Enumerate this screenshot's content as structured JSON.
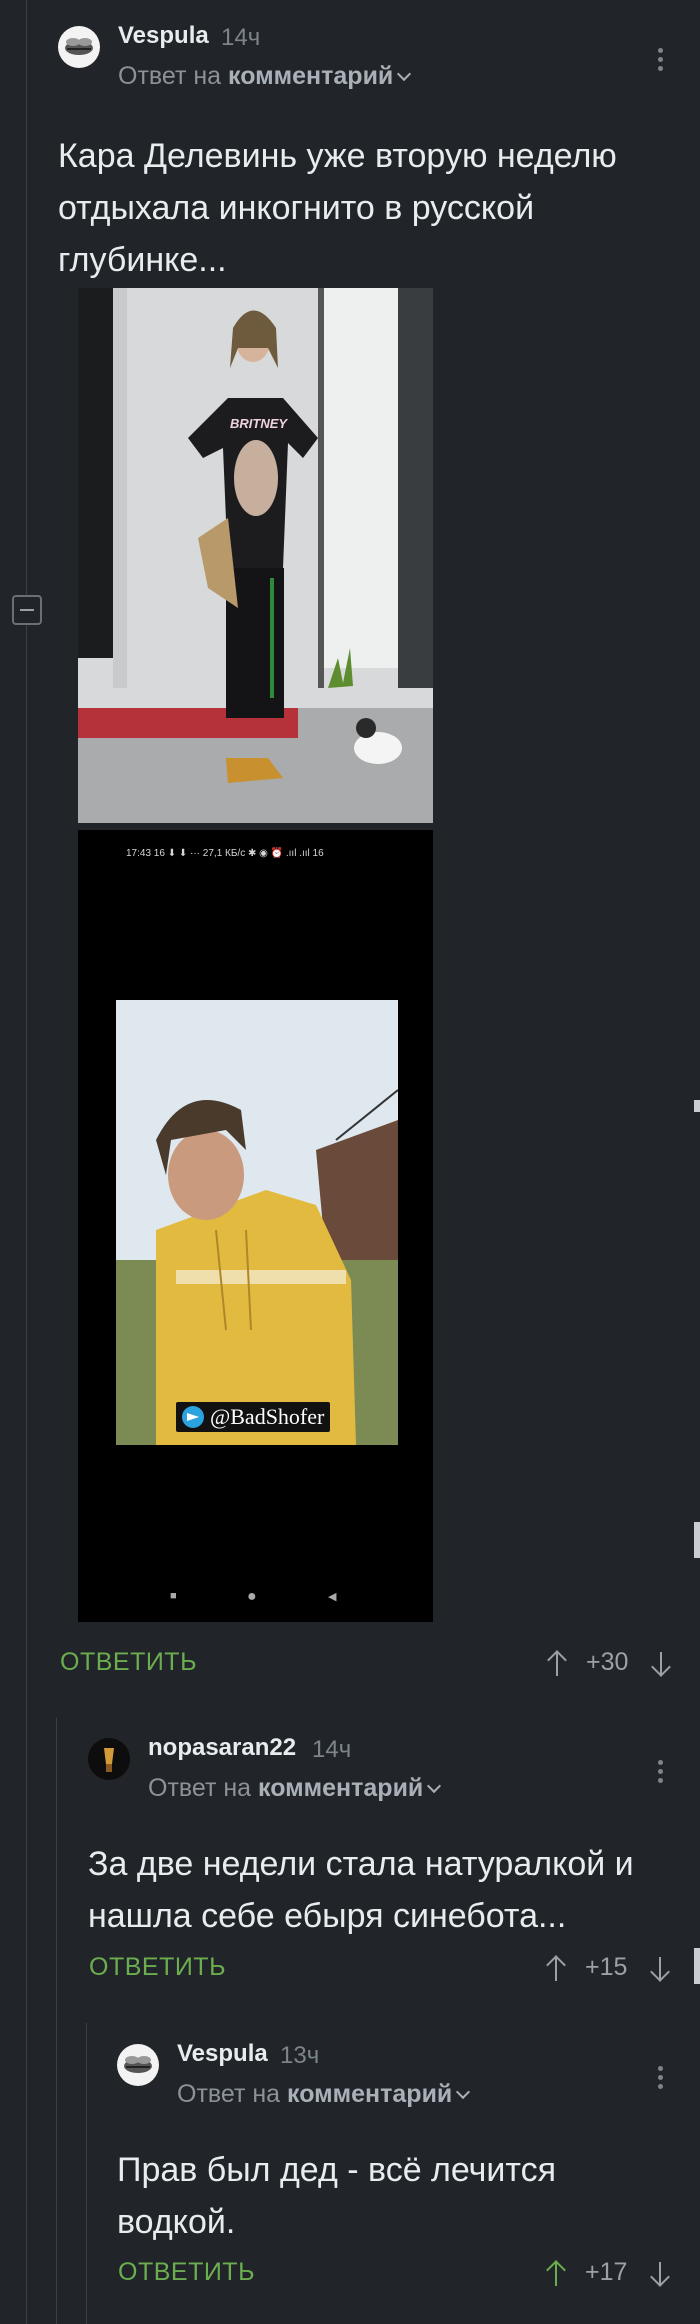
{
  "comments": [
    {
      "username": "Vespula",
      "time": "14ч",
      "reply_prefix": "Ответ на",
      "reply_target": "комментарий",
      "text": "Кара Делевинь уже вторую неделю отдыхала инкогнито в русской глубинке...",
      "reply_label": "ОТВЕТИТЬ",
      "rating": "+30"
    },
    {
      "username": "nopasaran22",
      "time": "14ч",
      "reply_prefix": "Ответ на",
      "reply_target": "комментарий",
      "text": "За две недели стала натуралкой и нашла себе ебыря синебота...",
      "reply_label": "ОТВЕТИТЬ",
      "rating": "+15"
    },
    {
      "username": "Vespula",
      "time": "13ч",
      "reply_prefix": "Ответ на",
      "reply_target": "комментарий",
      "text": "Прав был дед - всё лечится водкой.",
      "reply_label": "ОТВЕТИТЬ",
      "rating": "+17",
      "upvoted": true
    }
  ],
  "media": {
    "photo1_shirt_text": "BRITNEY",
    "status_bar": "17:43 16 ⬇ ⬇ ··· 27,1 КБ/с ✱ ◉ ⏰ .ııl .ııl 16",
    "watermark": "@BadShofer",
    "nav_buttons": [
      "■",
      "●",
      "◀"
    ]
  },
  "colors": {
    "background": "#212529",
    "accent_green": "#6bad4f",
    "muted": "#7d858c"
  },
  "icons": [
    "collapse-icon",
    "kebab-menu-icon",
    "chevron-down-icon",
    "arrow-up-icon",
    "arrow-down-icon",
    "telegram-icon"
  ]
}
